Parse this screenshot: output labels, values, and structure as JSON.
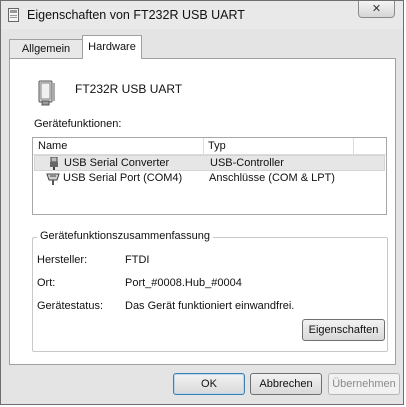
{
  "window": {
    "title": "Eigenschaften von FT232R USB UART",
    "close_glyph": "✕"
  },
  "tabs": [
    {
      "label": "Allgemein"
    },
    {
      "label": "Hardware"
    }
  ],
  "device": {
    "name": "FT232R USB UART",
    "icon": "usb-device-icon"
  },
  "functions": {
    "label": "Gerätefunktionen:",
    "columns": [
      "Name",
      "Typ"
    ],
    "rows": [
      {
        "name": "USB Serial Converter",
        "type": "USB-Controller",
        "icon": "usb-plug-icon",
        "selected": true
      },
      {
        "name": "USB Serial Port (COM4)",
        "type": "Anschlüsse (COM & LPT)",
        "icon": "serial-port-icon",
        "selected": false
      }
    ]
  },
  "summary": {
    "title": "Gerätefunktionszusammenfassung",
    "manufacturer_label": "Hersteller:",
    "manufacturer": "FTDI",
    "location_label": "Ort:",
    "location": "Port_#0008.Hub_#0004",
    "status_label": "Gerätestatus:",
    "status": "Das Gerät funktioniert einwandfrei.",
    "properties_button": "Eigenschaften"
  },
  "buttons": {
    "ok": "OK",
    "cancel": "Abbrechen",
    "apply": "Übernehmen"
  },
  "colors": {
    "selection": "#e6e6e6",
    "window_bg": "#e4e4e4",
    "default_button_border": "#3c7fb1"
  }
}
